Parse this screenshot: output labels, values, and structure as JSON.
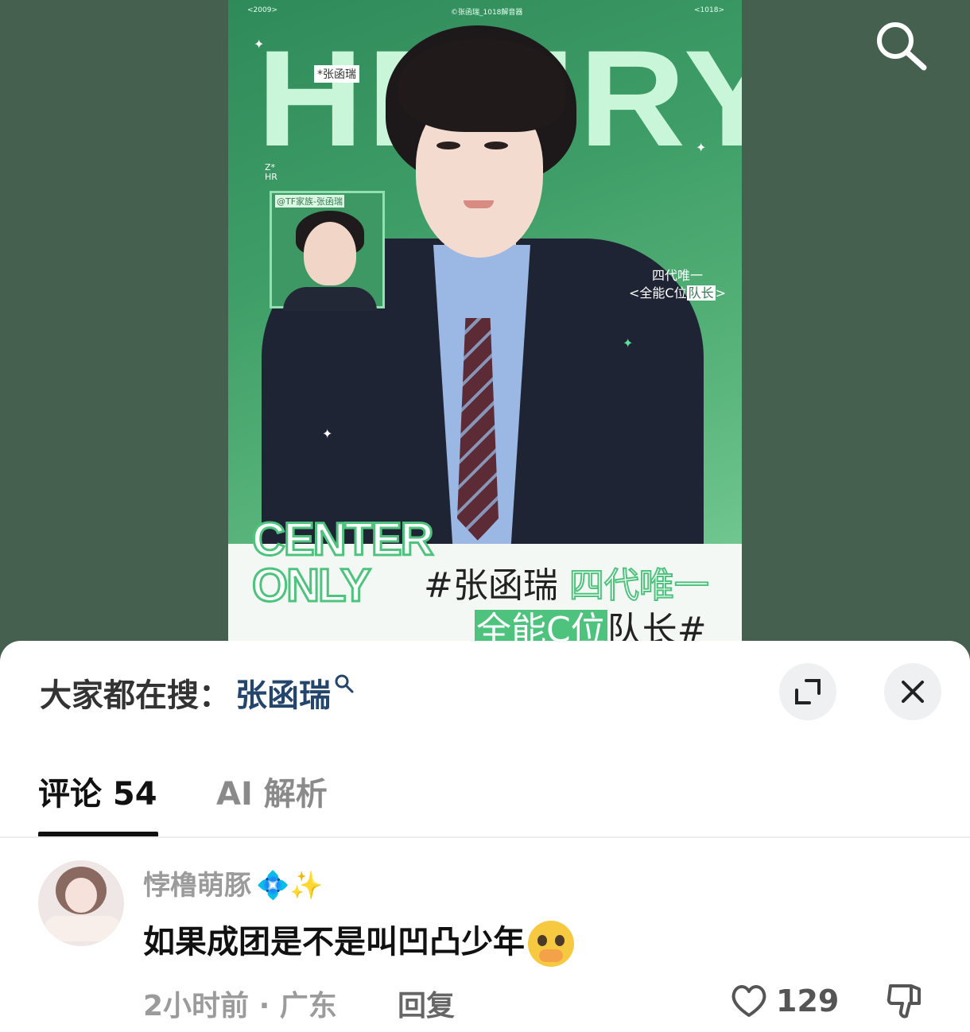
{
  "poster": {
    "top_left": "<2009>",
    "top_center": "©张函瑞_1018解音器",
    "top_right": "<1018>",
    "big_word": "HENRY",
    "name_tag": "*张函瑞",
    "zhr": "Z*\nHR",
    "thumb_label": "@TF家族-张函瑞",
    "side_tag_line1": "四代唯一",
    "side_tag_line2_prefix": "<全能C位",
    "side_tag_line2_hl": "队长",
    "side_tag_line2_suffix": ">",
    "center_only_line1": "CENTER",
    "center_only_line2": "ONLY",
    "hash1_prefix": "#张函瑞",
    "hash1_hl": "四代唯一",
    "hash2_hl": "全能C位",
    "hash2_suffix": "队长#"
  },
  "search_bar": {
    "label": "大家都在搜：",
    "keyword": "张函瑞"
  },
  "tabs": [
    {
      "label": "评论 54",
      "active": true
    },
    {
      "label": "AI 解析",
      "active": false
    }
  ],
  "comment": {
    "username": "悖橹萌豚",
    "username_emoji": "💠✨",
    "text": "如果成团是不是叫凹凸少年",
    "time_location": "2小时前 · 广东",
    "reply_label": "回复",
    "like_count": "129"
  },
  "colors": {
    "accent_green": "#4ec37d",
    "keyword_blue": "#24466d",
    "backdrop": "#47614f"
  }
}
